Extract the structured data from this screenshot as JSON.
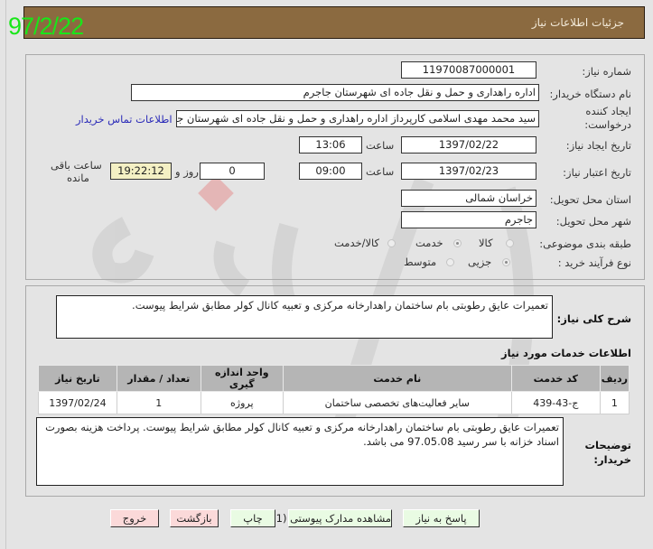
{
  "stamp": "97/2/22",
  "header": {
    "title": "جزئیات اطلاعات نیاز"
  },
  "form": {
    "need_number": {
      "label": "شماره نیاز:",
      "value": "1197008700000 1"
    },
    "buyer_org": {
      "label": "نام دستگاه خریدار:",
      "value": "اداره راهداری و حمل و نقل جاده ای شهرستان جاجرم"
    },
    "requester": {
      "label_line1": "ایجاد کننده",
      "label_line2": "درخواست:",
      "value": "سید محمد مهدی اسلامی کارپرداز اداره راهداری و حمل و نقل جاده ای شهرستان جاجرم",
      "contact_link": "اطلاعات تماس خریدار"
    },
    "created": {
      "label": "تاریخ ایجاد نیاز:",
      "date": "1397/02/22",
      "time_label": "ساعت",
      "time": "13:06"
    },
    "validity": {
      "label": "تاریخ اعتبار نیاز:",
      "date": "1397/02/23",
      "time_label": "ساعت",
      "time": "09:00",
      "days": "0",
      "days_label": "روز و",
      "remaining": "19:22:12",
      "remaining_label_line1": "ساعت باقی",
      "remaining_label_line2": "مانده"
    },
    "province": {
      "label": "استان محل تحویل:",
      "value": "خراسان شمالی"
    },
    "city": {
      "label": "شهر محل تحویل:",
      "value": "جاجرم"
    },
    "category": {
      "label": "طبقه بندی موضوعی:",
      "options": [
        "کالا",
        "خدمت",
        "کالا/خدمت"
      ],
      "selected": "خدمت"
    },
    "process": {
      "label": "نوع فرآیند خرید :",
      "options": [
        "جزیی",
        "متوسط"
      ],
      "selected": "جزیی"
    }
  },
  "description": {
    "label": "شرح کلی نیاز:",
    "value": "تعمیرات عایق رطوبتی بام ساختمان راهدارخانه مرکزی و تعبیه کانال کولر مطابق شرایط پیوست."
  },
  "services": {
    "title": "اطلاعات خدمات مورد نیاز",
    "columns": [
      "ردیف",
      "کد خدمت",
      "نام خدمت",
      "واحد اندازه گیری",
      "تعداد / مقدار",
      "تاریخ نیاز"
    ],
    "rows": [
      [
        "1",
        "ج-43-439",
        "سایر فعالیت‌های تخصصی ساختمان",
        "پروژه",
        "1",
        "1397/02/24"
      ]
    ]
  },
  "buyer_notes": {
    "label_line1": "توضیحات",
    "label_line2": "خریدار:",
    "value": "تعمیرات عایق رطوبتی بام ساختمان راهدارخانه مرکزی و تعبیه کانال کولر مطابق شرایط پیوست. پرداخت هزینه بصورت اسناد خزانه با سر رسید 97.05.08 می باشد."
  },
  "buttons": {
    "reply": "پاسخ به نیاز",
    "attachments": "مشاهده مدارک پیوستی (1)",
    "print": "چاپ",
    "back": "بازگشت",
    "exit": "خروج"
  }
}
